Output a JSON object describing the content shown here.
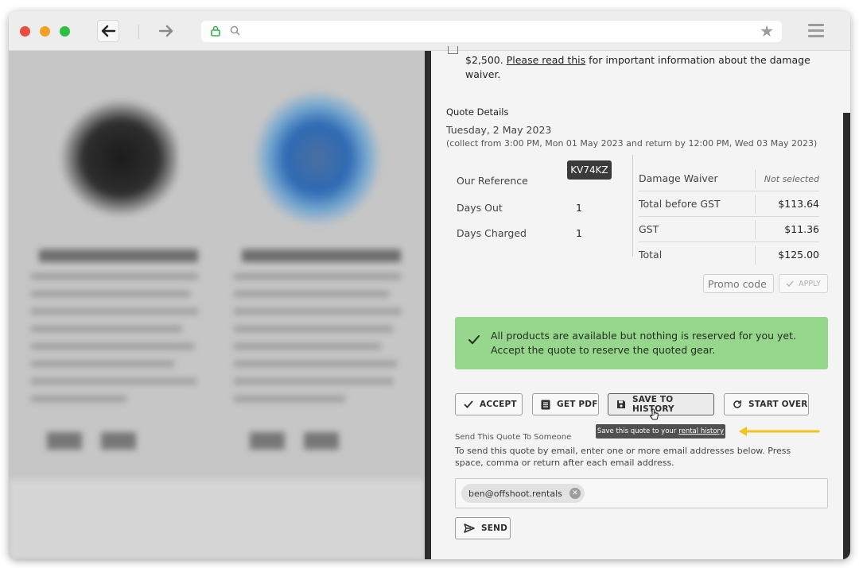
{
  "browser": {
    "url": ""
  },
  "waiver": {
    "text_prefix": "$2,500.",
    "link": "Please read this",
    "text_suffix": "for important information about the damage waiver."
  },
  "quote": {
    "title": "Quote Details",
    "date": "Tuesday, 2 May 2023",
    "collect": "(collect from 3:00 PM, Mon 01 May 2023 and return by 12:00 PM, Wed 03 May 2023)",
    "reference_label": "Our Reference",
    "reference": "KV74KZ",
    "days_out_label": "Days Out",
    "days_out": "1",
    "days_charged_label": "Days Charged",
    "days_charged": "1",
    "summary": [
      {
        "label": "Damage Waiver",
        "value": "Not selected"
      },
      {
        "label": "Total before GST",
        "value": "$113.64"
      },
      {
        "label": "GST",
        "value": "$11.36"
      },
      {
        "label": "Total",
        "value": "$125.00"
      }
    ],
    "promo_placeholder": "Promo code",
    "apply_label": "APPLY"
  },
  "alert": {
    "line1": "All products are available but nothing is reserved for you yet.",
    "line2": "Accept the quote to reserve the quoted gear.",
    "color": "#97d68d"
  },
  "actions": {
    "accept": "ACCEPT",
    "get_pdf": "GET PDF",
    "save_history": "SAVE TO HISTORY",
    "start_over": "START OVER"
  },
  "tooltip": {
    "text": "Save this quote to your",
    "link": "rental history"
  },
  "send": {
    "title": "Send This Quote To Someone",
    "description": "To send this quote by email, enter one or more email addresses below. Press space, comma or return after each email address.",
    "email_chip": "ben@offshoot.rentals",
    "button": "SEND"
  },
  "icons": [
    "back-arrow-icon",
    "forward-arrow-icon",
    "lock-icon",
    "search-icon",
    "star-icon",
    "hamburger-menu-icon",
    "check-icon",
    "document-icon",
    "floppy-disk-icon",
    "refresh-icon",
    "send-icon",
    "cursor-hand-icon",
    "close-icon"
  ],
  "annotation_color": "#f0c419"
}
